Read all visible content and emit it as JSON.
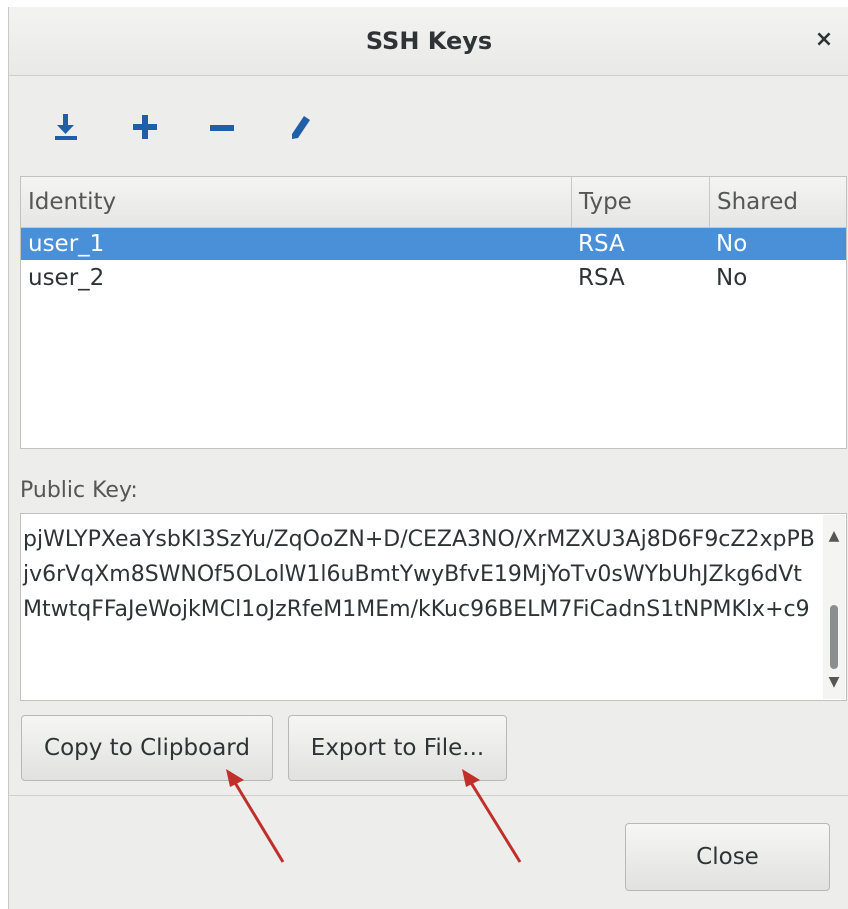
{
  "window": {
    "title": "SSH Keys",
    "close_glyph": "×"
  },
  "toolbar": [
    {
      "name": "import-key",
      "icon": "download-icon"
    },
    {
      "name": "add-key",
      "icon": "plus-icon"
    },
    {
      "name": "remove-key",
      "icon": "minus-icon"
    },
    {
      "name": "edit-key",
      "icon": "pencil-icon"
    }
  ],
  "table": {
    "headers": {
      "identity": "Identity",
      "type": "Type",
      "shared": "Shared"
    },
    "rows": [
      {
        "identity": "user_1",
        "type": "RSA",
        "shared": "No",
        "selected": true
      },
      {
        "identity": "user_2",
        "type": "RSA",
        "shared": "No",
        "selected": false
      }
    ]
  },
  "public_key": {
    "label": "Public Key:",
    "value": "pjWLYPXeaYsbKI3SzYu/ZqOoZN+D/CEZA3NO/XrMZXU3Aj8D6F9cZ2xpPBjv6rVqXm8SWNOf5OLolW1l6uBmtYwyBfvE19MjYoTv0sWYbUhJZkg6dVtMtwtqFFaJeWojkMCl1oJzRfeM1MEm/kKuc96BELM7FiCadnS1tNPMKlx+c9"
  },
  "buttons": {
    "copy": "Copy to Clipboard",
    "export": "Export to File...",
    "close": "Close"
  },
  "colors": {
    "selection": "#4a90d9",
    "toolbar_icon": "#1f5fa8",
    "annotation_arrow": "#c0302a"
  }
}
